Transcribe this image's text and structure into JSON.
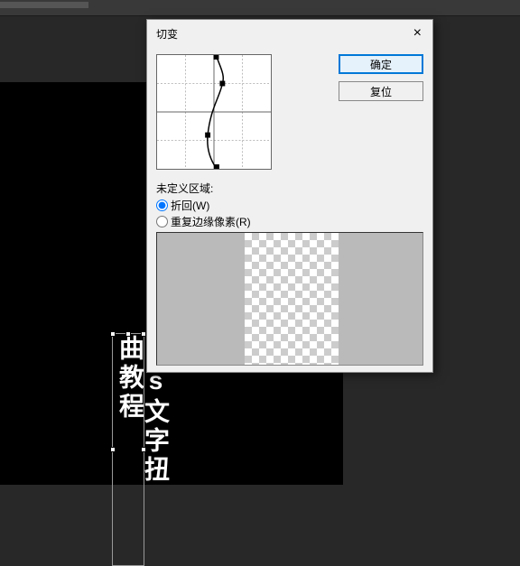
{
  "dialog": {
    "title": "切变",
    "ok_label": "确定",
    "reset_label": "复位",
    "close_label": "×"
  },
  "radio_group": {
    "label": "未定义区域:",
    "wrap_label": "折回(W)",
    "repeat_label": "重复边缘像素(R)"
  },
  "canvas": {
    "vertical_text": "Ps文字扭曲教程"
  },
  "chart_data": {
    "type": "line",
    "title": "",
    "xlabel": "",
    "ylabel": "",
    "xlim": [
      0,
      4
    ],
    "ylim": [
      0,
      4
    ],
    "control_points": [
      {
        "x": 2.08,
        "y": 0
      },
      {
        "x": 2.3,
        "y": 1
      },
      {
        "x": 1.78,
        "y": 2.8
      },
      {
        "x": 2.1,
        "y": 4
      }
    ]
  }
}
